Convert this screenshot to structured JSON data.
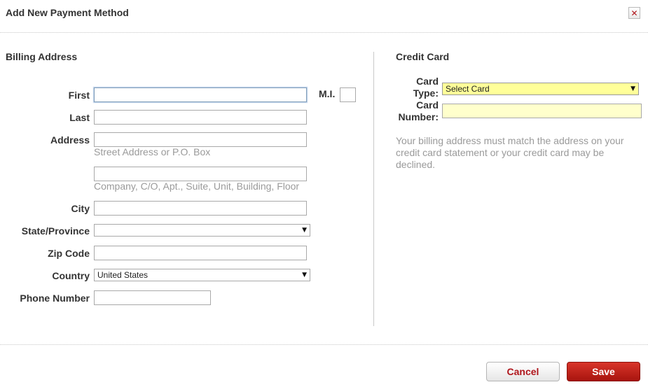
{
  "dialog": {
    "title": "Add New Payment Method",
    "close_icon": "close-icon",
    "close_glyph": "✕"
  },
  "billing": {
    "title": "Billing Address",
    "first_label": "First",
    "first_value": "",
    "mi_label": "M.I.",
    "mi_value": "",
    "last_label": "Last",
    "last_value": "",
    "address_label": "Address",
    "address1_value": "",
    "address1_hint": "Street Address or P.O. Box",
    "address2_value": "",
    "address2_hint": "Company, C/O, Apt., Suite, Unit, Building, Floor",
    "city_label": "City",
    "city_value": "",
    "state_label": "State/Province",
    "state_selected": "",
    "zip_label": "Zip Code",
    "zip_value": "",
    "country_label": "Country",
    "country_selected": "United States",
    "phone_label": "Phone Number",
    "phone_value": ""
  },
  "credit_card": {
    "title": "Credit Card",
    "type_label_line1": "Card",
    "type_label_line2": "Type:",
    "type_selected": "Select Card",
    "number_label_line1": "Card",
    "number_label_line2": "Number:",
    "number_value": "",
    "note": "Your billing address must match the address on your credit card statement or your credit card may be declined."
  },
  "footer": {
    "cancel_label": "Cancel",
    "save_label": "Save"
  },
  "colors": {
    "brand_red": "#b0161c",
    "input_highlight": "#ffffcc"
  },
  "icons": {
    "dropdown": "chevron-down-icon",
    "dropdown_glyph": "▼"
  }
}
